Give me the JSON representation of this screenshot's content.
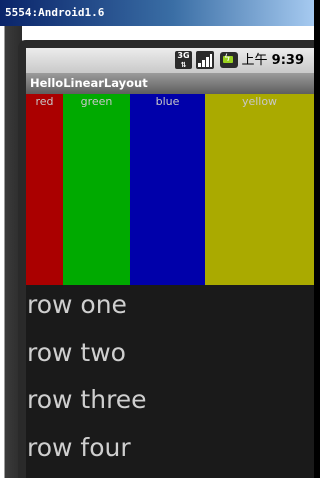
{
  "window": {
    "title": "5554:Android1.6"
  },
  "statusbar": {
    "network_badge": "3G",
    "signal_icon": "signal-bars-icon",
    "battery_icon": "battery-charging-icon",
    "time_prefix": "上午",
    "time": "9:39"
  },
  "app": {
    "title": "HelloLinearLayout"
  },
  "colors": [
    {
      "label": "red",
      "color": "#aa0000"
    },
    {
      "label": "green",
      "color": "#00aa00"
    },
    {
      "label": "blue",
      "color": "#0000aa"
    },
    {
      "label": "yellow",
      "color": "#aaaa00"
    }
  ],
  "rows": [
    {
      "label": "row one"
    },
    {
      "label": "row two"
    },
    {
      "label": "row three"
    },
    {
      "label": "row four"
    }
  ]
}
